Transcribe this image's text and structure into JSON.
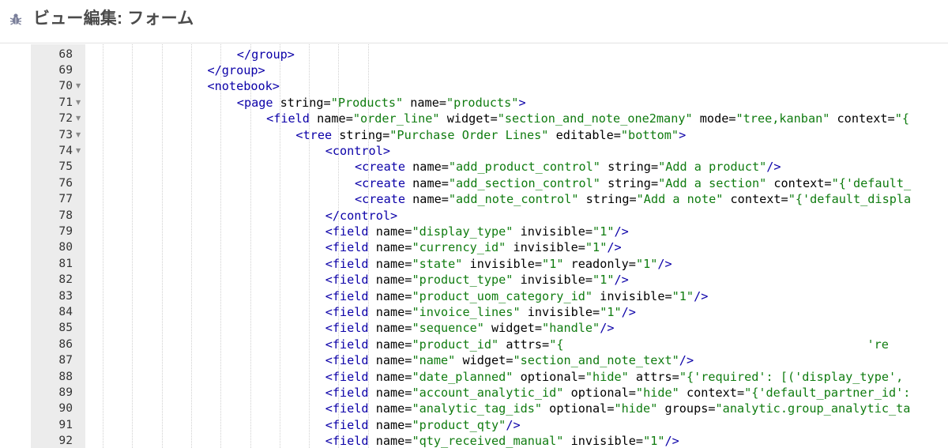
{
  "header": {
    "title": "ビュー編集: フォーム",
    "icon": "bug-icon"
  },
  "editor": {
    "first_line": 68,
    "folded_lines": [
      70,
      71,
      72,
      73,
      74
    ],
    "lines": [
      {
        "n": 68,
        "indent": 6,
        "t": [
          [
            "tag",
            "</group>"
          ]
        ]
      },
      {
        "n": 69,
        "indent": 5,
        "t": [
          [
            "tag",
            "</group>"
          ]
        ]
      },
      {
        "n": 70,
        "indent": 5,
        "t": [
          [
            "tag",
            "<notebook>"
          ]
        ]
      },
      {
        "n": 71,
        "indent": 6,
        "t": [
          [
            "tag",
            "<page"
          ],
          [
            "attr",
            " string"
          ],
          [
            "eq",
            "="
          ],
          [
            "str",
            "\"Products\""
          ],
          [
            "attr",
            " name"
          ],
          [
            "eq",
            "="
          ],
          [
            "str",
            "\"products\""
          ],
          [
            "tag",
            ">"
          ]
        ]
      },
      {
        "n": 72,
        "indent": 7,
        "t": [
          [
            "tag",
            "<field"
          ],
          [
            "attr",
            " name"
          ],
          [
            "eq",
            "="
          ],
          [
            "str",
            "\"order_line\""
          ],
          [
            "attr",
            " widget"
          ],
          [
            "eq",
            "="
          ],
          [
            "str",
            "\"section_and_note_one2many\""
          ],
          [
            "attr",
            " mode"
          ],
          [
            "eq",
            "="
          ],
          [
            "str",
            "\"tree,kanban\""
          ],
          [
            "attr",
            " context"
          ],
          [
            "eq",
            "="
          ],
          [
            "str",
            "\"{"
          ]
        ]
      },
      {
        "n": 73,
        "indent": 8,
        "t": [
          [
            "tag",
            "<tree"
          ],
          [
            "attr",
            " string"
          ],
          [
            "eq",
            "="
          ],
          [
            "str",
            "\"Purchase Order Lines\""
          ],
          [
            "attr",
            " editable"
          ],
          [
            "eq",
            "="
          ],
          [
            "str",
            "\"bottom\""
          ],
          [
            "tag",
            ">"
          ]
        ]
      },
      {
        "n": 74,
        "indent": 9,
        "t": [
          [
            "tag",
            "<control>"
          ]
        ]
      },
      {
        "n": 75,
        "indent": 10,
        "t": [
          [
            "tag",
            "<create"
          ],
          [
            "attr",
            " name"
          ],
          [
            "eq",
            "="
          ],
          [
            "str",
            "\"add_product_control\""
          ],
          [
            "attr",
            " string"
          ],
          [
            "eq",
            "="
          ],
          [
            "str",
            "\"Add a product\""
          ],
          [
            "tag",
            "/>"
          ]
        ]
      },
      {
        "n": 76,
        "indent": 10,
        "t": [
          [
            "tag",
            "<create"
          ],
          [
            "attr",
            " name"
          ],
          [
            "eq",
            "="
          ],
          [
            "str",
            "\"add_section_control\""
          ],
          [
            "attr",
            " string"
          ],
          [
            "eq",
            "="
          ],
          [
            "str",
            "\"Add a section\""
          ],
          [
            "attr",
            " context"
          ],
          [
            "eq",
            "="
          ],
          [
            "str",
            "\"{'default_"
          ]
        ]
      },
      {
        "n": 77,
        "indent": 10,
        "t": [
          [
            "tag",
            "<create"
          ],
          [
            "attr",
            " name"
          ],
          [
            "eq",
            "="
          ],
          [
            "str",
            "\"add_note_control\""
          ],
          [
            "attr",
            " string"
          ],
          [
            "eq",
            "="
          ],
          [
            "str",
            "\"Add a note\""
          ],
          [
            "attr",
            " context"
          ],
          [
            "eq",
            "="
          ],
          [
            "str",
            "\"{'default_displa"
          ]
        ]
      },
      {
        "n": 78,
        "indent": 9,
        "t": [
          [
            "tag",
            "</control>"
          ]
        ]
      },
      {
        "n": 79,
        "indent": 9,
        "t": [
          [
            "tag",
            "<field"
          ],
          [
            "attr",
            " name"
          ],
          [
            "eq",
            "="
          ],
          [
            "str",
            "\"display_type\""
          ],
          [
            "attr",
            " invisible"
          ],
          [
            "eq",
            "="
          ],
          [
            "str",
            "\"1\""
          ],
          [
            "tag",
            "/>"
          ]
        ]
      },
      {
        "n": 80,
        "indent": 9,
        "t": [
          [
            "tag",
            "<field"
          ],
          [
            "attr",
            " name"
          ],
          [
            "eq",
            "="
          ],
          [
            "str",
            "\"currency_id\""
          ],
          [
            "attr",
            " invisible"
          ],
          [
            "eq",
            "="
          ],
          [
            "str",
            "\"1\""
          ],
          [
            "tag",
            "/>"
          ]
        ]
      },
      {
        "n": 81,
        "indent": 9,
        "t": [
          [
            "tag",
            "<field"
          ],
          [
            "attr",
            " name"
          ],
          [
            "eq",
            "="
          ],
          [
            "str",
            "\"state\""
          ],
          [
            "attr",
            " invisible"
          ],
          [
            "eq",
            "="
          ],
          [
            "str",
            "\"1\""
          ],
          [
            "attr",
            " readonly"
          ],
          [
            "eq",
            "="
          ],
          [
            "str",
            "\"1\""
          ],
          [
            "tag",
            "/>"
          ]
        ]
      },
      {
        "n": 82,
        "indent": 9,
        "t": [
          [
            "tag",
            "<field"
          ],
          [
            "attr",
            " name"
          ],
          [
            "eq",
            "="
          ],
          [
            "str",
            "\"product_type\""
          ],
          [
            "attr",
            " invisible"
          ],
          [
            "eq",
            "="
          ],
          [
            "str",
            "\"1\""
          ],
          [
            "tag",
            "/>"
          ]
        ]
      },
      {
        "n": 83,
        "indent": 9,
        "t": [
          [
            "tag",
            "<field"
          ],
          [
            "attr",
            " name"
          ],
          [
            "eq",
            "="
          ],
          [
            "str",
            "\"product_uom_category_id\""
          ],
          [
            "attr",
            " invisible"
          ],
          [
            "eq",
            "="
          ],
          [
            "str",
            "\"1\""
          ],
          [
            "tag",
            "/>"
          ]
        ]
      },
      {
        "n": 84,
        "indent": 9,
        "t": [
          [
            "tag",
            "<field"
          ],
          [
            "attr",
            " name"
          ],
          [
            "eq",
            "="
          ],
          [
            "str",
            "\"invoice_lines\""
          ],
          [
            "attr",
            " invisible"
          ],
          [
            "eq",
            "="
          ],
          [
            "str",
            "\"1\""
          ],
          [
            "tag",
            "/>"
          ]
        ]
      },
      {
        "n": 85,
        "indent": 9,
        "t": [
          [
            "tag",
            "<field"
          ],
          [
            "attr",
            " name"
          ],
          [
            "eq",
            "="
          ],
          [
            "str",
            "\"sequence\""
          ],
          [
            "attr",
            " widget"
          ],
          [
            "eq",
            "="
          ],
          [
            "str",
            "\"handle\""
          ],
          [
            "tag",
            "/>"
          ]
        ]
      },
      {
        "n": 86,
        "indent": 9,
        "t": [
          [
            "tag",
            "<field"
          ],
          [
            "attr",
            " name"
          ],
          [
            "eq",
            "="
          ],
          [
            "str",
            "\"product_id\""
          ],
          [
            "attr",
            " attrs"
          ],
          [
            "eq",
            "="
          ],
          [
            "str",
            "\"{                                          're"
          ]
        ]
      },
      {
        "n": 87,
        "indent": 9,
        "t": [
          [
            "tag",
            "<field"
          ],
          [
            "attr",
            " name"
          ],
          [
            "eq",
            "="
          ],
          [
            "str",
            "\"name\""
          ],
          [
            "attr",
            " widget"
          ],
          [
            "eq",
            "="
          ],
          [
            "str",
            "\"section_and_note_text\""
          ],
          [
            "tag",
            "/>"
          ]
        ]
      },
      {
        "n": 88,
        "indent": 9,
        "t": [
          [
            "tag",
            "<field"
          ],
          [
            "attr",
            " name"
          ],
          [
            "eq",
            "="
          ],
          [
            "str",
            "\"date_planned\""
          ],
          [
            "attr",
            " optional"
          ],
          [
            "eq",
            "="
          ],
          [
            "str",
            "\"hide\""
          ],
          [
            "attr",
            " attrs"
          ],
          [
            "eq",
            "="
          ],
          [
            "str",
            "\"{'required': [('display_type',"
          ]
        ]
      },
      {
        "n": 89,
        "indent": 9,
        "t": [
          [
            "tag",
            "<field"
          ],
          [
            "attr",
            " name"
          ],
          [
            "eq",
            "="
          ],
          [
            "str",
            "\"account_analytic_id\""
          ],
          [
            "attr",
            " optional"
          ],
          [
            "eq",
            "="
          ],
          [
            "str",
            "\"hide\""
          ],
          [
            "attr",
            " context"
          ],
          [
            "eq",
            "="
          ],
          [
            "str",
            "\"{'default_partner_id':"
          ]
        ]
      },
      {
        "n": 90,
        "indent": 9,
        "t": [
          [
            "tag",
            "<field"
          ],
          [
            "attr",
            " name"
          ],
          [
            "eq",
            "="
          ],
          [
            "str",
            "\"analytic_tag_ids\""
          ],
          [
            "attr",
            " optional"
          ],
          [
            "eq",
            "="
          ],
          [
            "str",
            "\"hide\""
          ],
          [
            "attr",
            " groups"
          ],
          [
            "eq",
            "="
          ],
          [
            "str",
            "\"analytic.group_analytic_ta"
          ]
        ]
      },
      {
        "n": 91,
        "indent": 9,
        "t": [
          [
            "tag",
            "<field"
          ],
          [
            "attr",
            " name"
          ],
          [
            "eq",
            "="
          ],
          [
            "str",
            "\"product_qty\""
          ],
          [
            "tag",
            "/>"
          ]
        ]
      },
      {
        "n": 92,
        "indent": 9,
        "t": [
          [
            "tag",
            "<field"
          ],
          [
            "attr",
            " name"
          ],
          [
            "eq",
            "="
          ],
          [
            "str",
            "\"qty_received_manual\""
          ],
          [
            "attr",
            " invisible"
          ],
          [
            "eq",
            "="
          ],
          [
            "str",
            "\"1\""
          ],
          [
            "tag",
            "/>"
          ]
        ]
      }
    ]
  },
  "colors": {
    "tag": "#0b00a8",
    "string": "#107c10",
    "gutter": "#ececec"
  }
}
